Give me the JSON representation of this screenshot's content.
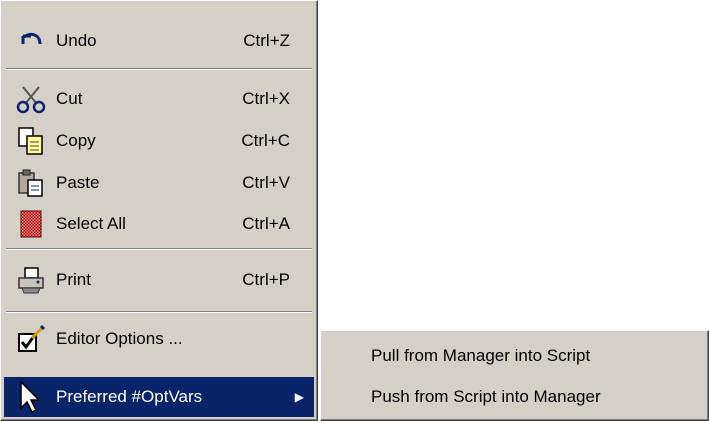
{
  "edit_menu": {
    "undo": {
      "label": "Undo",
      "shortcut": "Ctrl+Z",
      "icon": "undo-arrow-icon"
    },
    "cut": {
      "label": "Cut",
      "shortcut": "Ctrl+X",
      "icon": "scissors-icon"
    },
    "copy": {
      "label": "Copy",
      "shortcut": "Ctrl+C",
      "icon": "copy-pages-icon"
    },
    "paste": {
      "label": "Paste",
      "shortcut": "Ctrl+V",
      "icon": "paste-icon"
    },
    "select_all": {
      "label": "Select All",
      "shortcut": "Ctrl+A",
      "icon": "select-all-icon"
    },
    "print": {
      "label": "Print",
      "shortcut": "Ctrl+P",
      "icon": "printer-icon"
    },
    "editor_options": {
      "label": "Editor Options ...",
      "icon": "checkbox-pencil-icon"
    },
    "preferred_optvars": {
      "label": "Preferred #OptVars",
      "icon": "pointer-arrow-icon",
      "submenu_arrow": "▶"
    }
  },
  "submenu": {
    "pull": "Pull from Manager into Script",
    "push": "Push from Script into Manager"
  },
  "colors": {
    "menu_bg": "#d4d0c8",
    "highlight": "#0a246a",
    "highlight_text": "#ffffff"
  }
}
